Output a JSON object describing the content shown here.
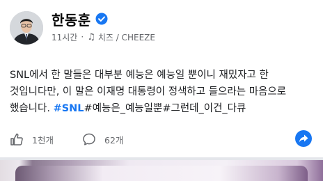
{
  "post": {
    "author": "한동훈",
    "time": "11시간",
    "separator": "·",
    "audio": "치즈 / CHEEZE",
    "text_line1": "SNL에서 한 말들은 대부분 예능은 예능일 뿐이니 재밌자고 한",
    "text_line2": "것입니다만, 이 말은 이재명 대통령이 정색하고 들으라는 마음으로",
    "text_line3_prefix": "했습니다. ",
    "hashtag_main": "#SNL",
    "hashtags_rest": "#예능은_예능일뿐#그런데_이건_다큐"
  },
  "actions": {
    "likes": "1천개",
    "comments": "62개"
  },
  "icons": {
    "verified": "verified-badge-icon",
    "music": "music-note-icon",
    "like": "thumbs-up-icon",
    "comment": "comment-icon",
    "share": "share-icon"
  },
  "colors": {
    "accent": "#1877f2",
    "secondary_text": "#65676b"
  }
}
